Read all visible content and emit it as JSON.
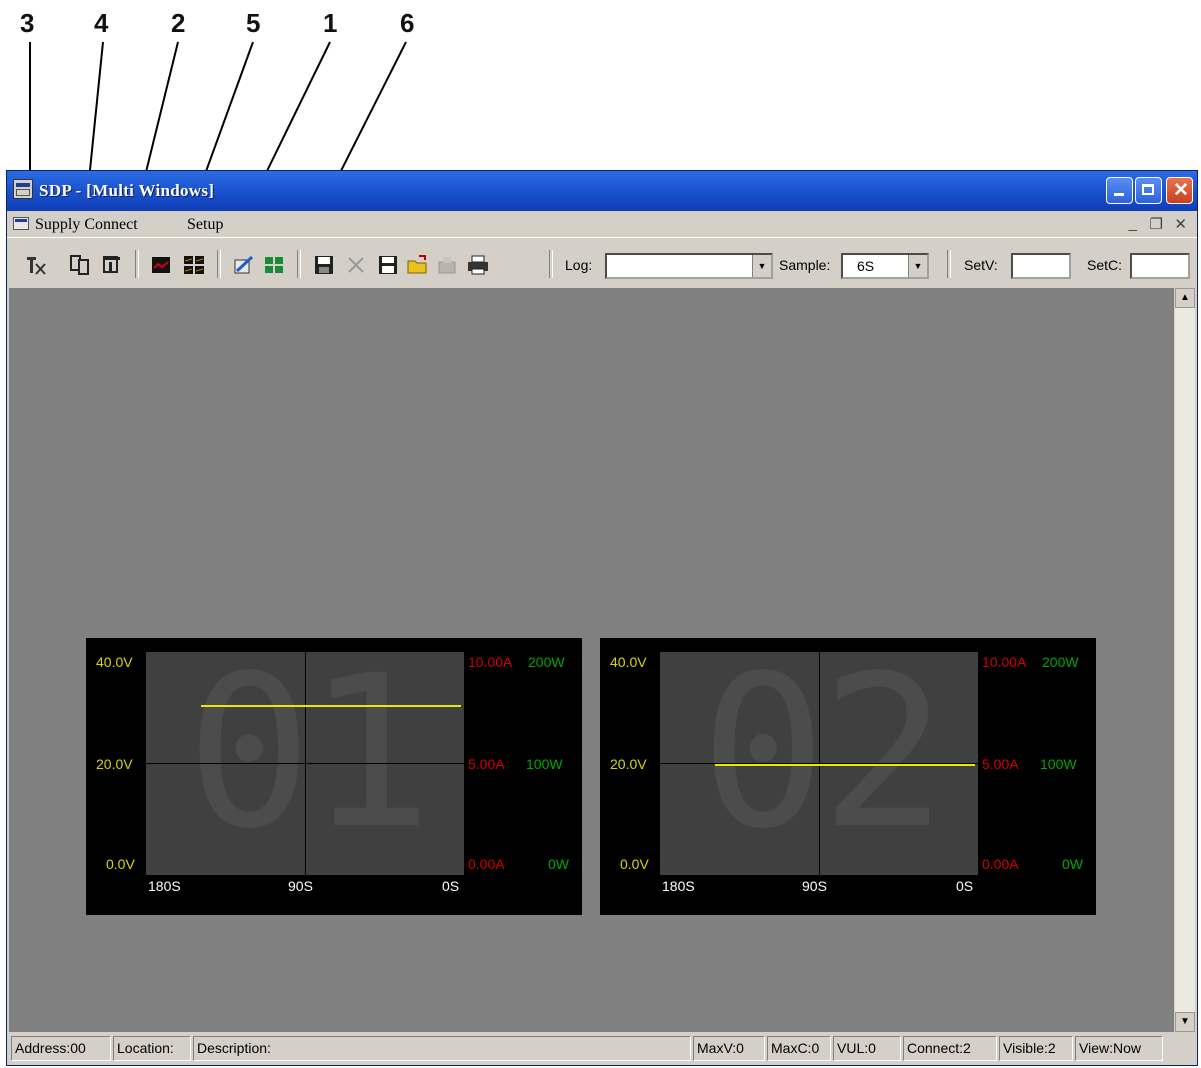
{
  "callouts": [
    "3",
    "4",
    "2",
    "5",
    "1",
    "6"
  ],
  "window": {
    "title": "SDP - [Multi Windows]"
  },
  "menu": {
    "items": [
      "Supply Connect",
      "Setup"
    ]
  },
  "toolbar": {
    "log_label": "Log:",
    "log_value": "",
    "sample_label": "Sample:",
    "sample_value": "6S",
    "setv_label": "SetV:",
    "setc_label": "SetC:",
    "icons": [
      "tx-icon",
      "copy-connect-icon",
      "disconnect-icon",
      "single-graph-icon",
      "multi-graph-icon",
      "edit-icon",
      "grid-icon",
      "save-icon",
      "delete-icon",
      "save-as-icon",
      "open-folder-icon",
      "export-icon",
      "print-icon"
    ]
  },
  "panels": [
    {
      "id": "01",
      "v_labels": [
        "40.0V",
        "20.0V",
        "0.0V"
      ],
      "a_labels": [
        "10.00A",
        "5.00A",
        "0.00A"
      ],
      "w_labels": [
        "200W",
        "100W",
        "0W"
      ],
      "x_labels": [
        "180S",
        "90S",
        "0S"
      ],
      "voltage": 30.5
    },
    {
      "id": "02",
      "v_labels": [
        "40.0V",
        "20.0V",
        "0.0V"
      ],
      "a_labels": [
        "10.00A",
        "5.00A",
        "0.00A"
      ],
      "w_labels": [
        "200W",
        "100W",
        "0W"
      ],
      "x_labels": [
        "180S",
        "90S",
        "0S"
      ],
      "voltage": 20.0
    }
  ],
  "status": {
    "address": "Address:00",
    "location": "Location:",
    "description": "Description:",
    "maxv": "MaxV:0",
    "maxc": "MaxC:0",
    "vul": "VUL:0",
    "connect": "Connect:2",
    "visible": "Visible:2",
    "view": "View:Now"
  },
  "colors": {
    "voltage": "#d8d800",
    "current": "#d40000",
    "power": "#00a800",
    "title_bar": "#1c55cf"
  }
}
